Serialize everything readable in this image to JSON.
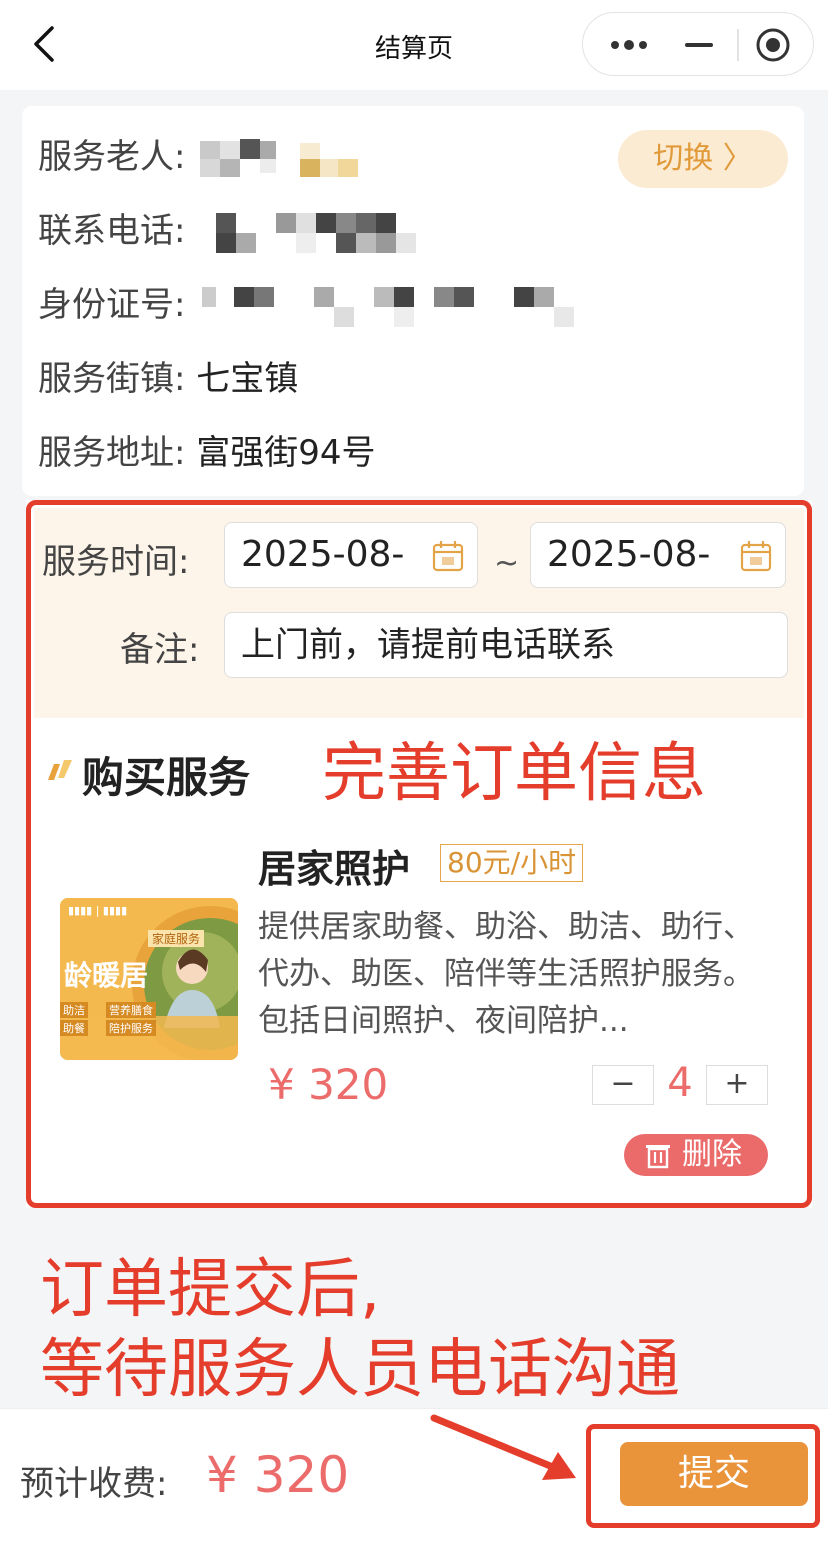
{
  "nav": {
    "title": "结算页"
  },
  "elder": {
    "name_label": "服务老人:",
    "phone_label": "联系电话:",
    "id_label": "身份证号:",
    "town_label": "服务街镇:",
    "town_value": "七宝镇",
    "address_label": "服务地址:",
    "address_value": "富强街94号",
    "switch_label": "切换 〉"
  },
  "order": {
    "time_label": "服务时间:",
    "start_date": "2025-08-",
    "end_date": "2025-08-",
    "tilde": "~",
    "note_label": "备注:",
    "note_value": "上门前，请提前电话联系",
    "section_title": "购买服务",
    "service": {
      "name": "居家照护",
      "unit_price": "80元/小时",
      "description": "提供居家助餐、助浴、助洁、助行、代办、助医、陪伴等生活照护服务。包括日间照护、夜间陪护...",
      "price": "¥ 320",
      "quantity": "4",
      "minus": "−",
      "plus": "+",
      "delete_label": "删除",
      "thumb_text": "龄暖居",
      "thumb_tag": "家庭服务",
      "thumb_chips": [
        "助洁",
        "营养膳食",
        "助餐",
        "陪护服务"
      ]
    }
  },
  "annotations": {
    "complete_order": "完善订单信息",
    "after_submit_line1": "订单提交后,",
    "after_submit_line2": "等待服务人员电话沟通"
  },
  "footer": {
    "fee_label": "预计收费:",
    "fee_value": "¥ 320",
    "submit_label": "提交"
  },
  "colors": {
    "accent": "#e9933a",
    "price": "#ec6b6b",
    "annotation": "#e53d2b",
    "switch_bg": "#fcebd3"
  }
}
